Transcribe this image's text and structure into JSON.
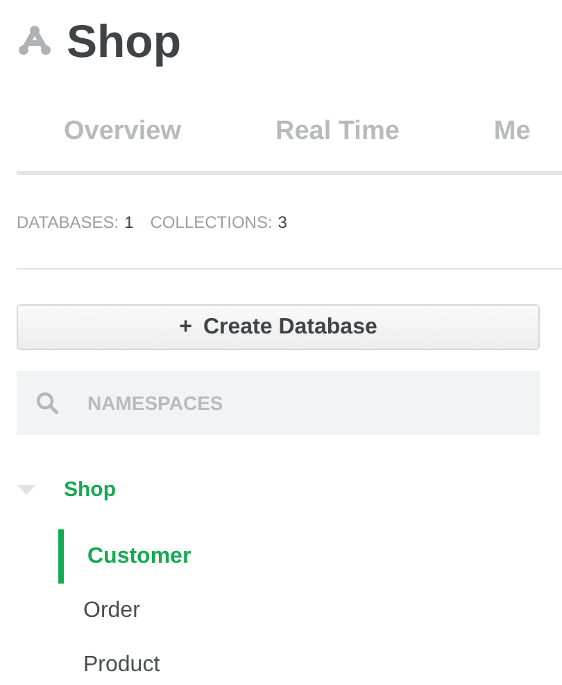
{
  "header": {
    "title": "Shop"
  },
  "tabs": [
    {
      "label": "Overview",
      "selected": false
    },
    {
      "label": "Real Time",
      "selected": false
    },
    {
      "label": "Me",
      "selected": false
    }
  ],
  "stats": [
    {
      "label": "DATABASES:",
      "value": "1"
    },
    {
      "label": "COLLECTIONS:",
      "value": "3"
    }
  ],
  "create_button": {
    "label": "Create Database",
    "icon": "+"
  },
  "search": {
    "placeholder": "NAMESPACES"
  },
  "tree": [
    {
      "label": "Shop",
      "expanded": true,
      "children": [
        {
          "label": "Customer",
          "selected": true
        },
        {
          "label": "Order",
          "selected": false
        },
        {
          "label": "Product",
          "selected": false
        }
      ]
    }
  ]
}
